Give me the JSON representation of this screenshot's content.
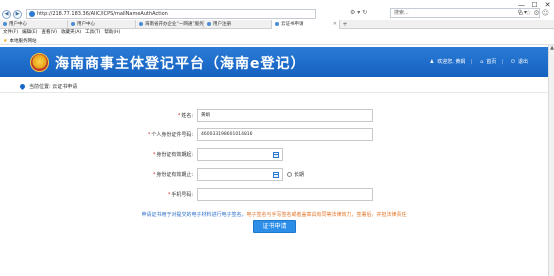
{
  "window": {
    "minimize": "—",
    "maximize": "☐",
    "close": "✕"
  },
  "browser": {
    "url": "http://218.77.183.36/AIIC/ICPS/mallNameAuthAction",
    "search_placeholder": "搜索...",
    "tabs": [
      {
        "label": "用户中心",
        "active": false
      },
      {
        "label": "用户中心",
        "active": false
      },
      {
        "label": "海南省开办企业“一网通”服务",
        "active": false
      },
      {
        "label": "用户注册",
        "active": false
      },
      {
        "label": "云证书申请",
        "active": true
      }
    ],
    "menu": [
      "文件(F)",
      "编辑(E)",
      "查看(V)",
      "收藏夹(A)",
      "工具(T)",
      "帮助(H)"
    ],
    "favorites": [
      "本地服务网站"
    ]
  },
  "banner": {
    "title": "海南商事主体登记平台（海南e登记）",
    "links": {
      "welcome": "欢迎您, 黄娟",
      "home": "首页",
      "logout": "退出"
    }
  },
  "breadcrumb": "当前位置: 云证书申请",
  "form": {
    "name": {
      "label": "姓名:",
      "value": "黄娟"
    },
    "id_number": {
      "label": "个人身份证件号码:",
      "value": "460033198601014816"
    },
    "id_start": {
      "label": "身份证有效期起:",
      "value": ""
    },
    "id_end": {
      "label": "身份证有效期止:",
      "value": "",
      "longterm_label": "长期"
    },
    "phone": {
      "label": "手机号码:",
      "value": ""
    }
  },
  "note": {
    "blue": "申请证书用于对提交的电子材料进行电子签名，",
    "orange": "电子签名与手写签名或者盖章具有同等法律效力，签署后，并担法律责任"
  },
  "submit_label": "证书申请",
  "colors": {
    "banner": "#1a66c8",
    "button": "#2d8ee8",
    "required": "#e03030"
  }
}
